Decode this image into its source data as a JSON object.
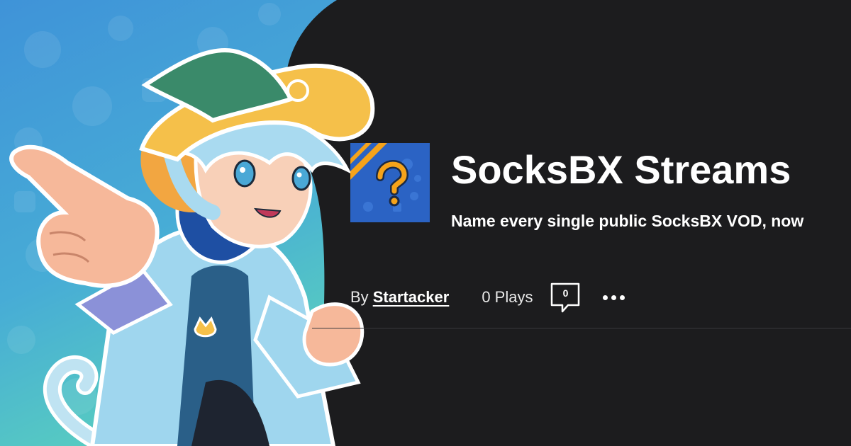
{
  "quiz": {
    "title": "SocksBX Streams",
    "description": "Name every single public SocksBX VOD, now",
    "by_label": "By",
    "author": "Startacker",
    "plays": "0 Plays",
    "comment_count": "0"
  },
  "icons": {
    "thumbnail": "question-mark-icon",
    "comments": "speech-bubble-icon",
    "more": "ellipsis-icon"
  },
  "colors": {
    "background": "#1c1c1e",
    "text": "#ffffff",
    "thumbnail_blue": "#2b63c4",
    "question_mark": "#f5a31a",
    "art_teal": "#4fc2c8",
    "art_blue": "#3f93d8"
  }
}
